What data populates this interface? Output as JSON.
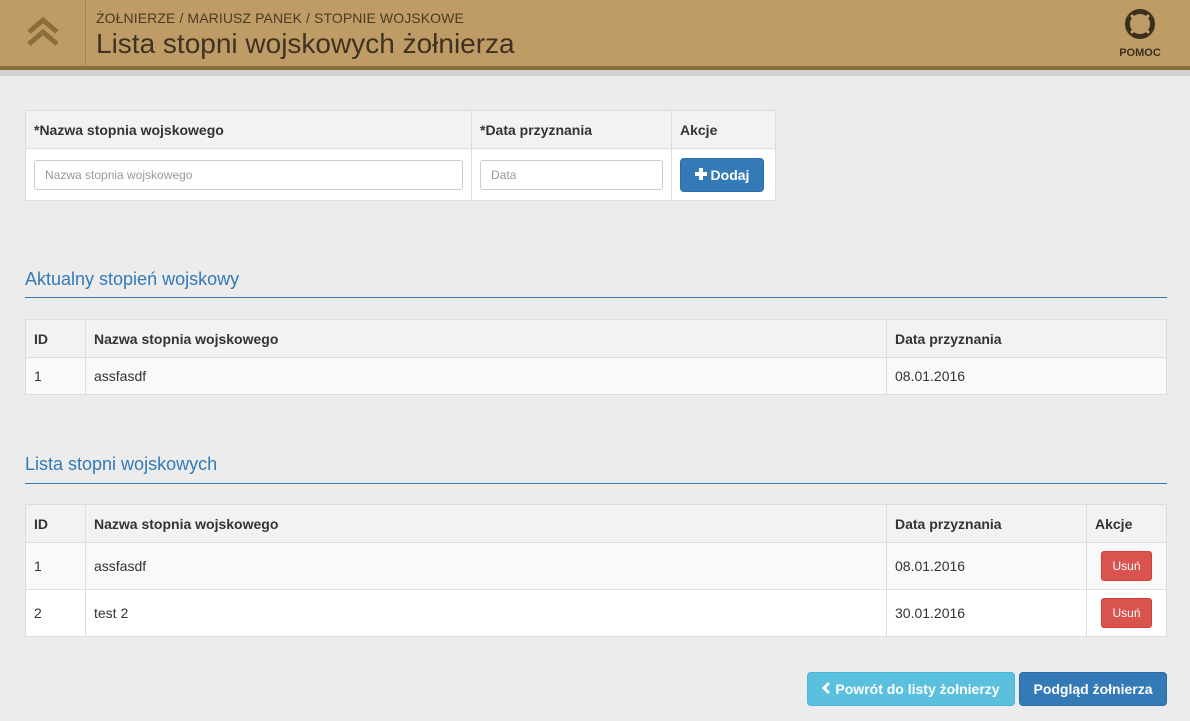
{
  "header": {
    "breadcrumb": "ŻOŁNIERZE / MARIUSZ PANEK / STOPNIE WOJSKOWE",
    "title": "Lista stopni wojskowych żołnierza",
    "help_label": "POMOC"
  },
  "form": {
    "headers": [
      "*Nazwa stopnia wojskowego",
      "*Data przyznania",
      "Akcje"
    ],
    "name_placeholder": "Nazwa stopnia wojskowego",
    "date_placeholder": "Data",
    "add_label": "Dodaj"
  },
  "current": {
    "title": "Aktualny stopień wojskowy",
    "headers": [
      "ID",
      "Nazwa stopnia wojskowego",
      "Data przyznania"
    ],
    "rows": [
      {
        "id": "1",
        "name": "assfasdf",
        "date": "08.01.2016"
      }
    ]
  },
  "list": {
    "title": "Lista stopni wojskowych",
    "headers": [
      "ID",
      "Nazwa stopnia wojskowego",
      "Data przyznania",
      "Akcje"
    ],
    "rows": [
      {
        "id": "1",
        "name": "assfasdf",
        "date": "08.01.2016",
        "action": "Usuń"
      },
      {
        "id": "2",
        "name": "test 2",
        "date": "30.01.2016",
        "action": "Usuń"
      }
    ]
  },
  "footer": {
    "back_label": "Powrót do listy żołnierzy",
    "view_label": "Podgląd żołnierza"
  },
  "colors": {
    "header_bg": "#bf9c65",
    "primary": "#337ab7",
    "info": "#5bc0de",
    "danger": "#d9534f"
  },
  "icons": [
    "double-chevron-up-icon",
    "lifebuoy-icon",
    "plus-icon",
    "chevron-left-icon"
  ]
}
